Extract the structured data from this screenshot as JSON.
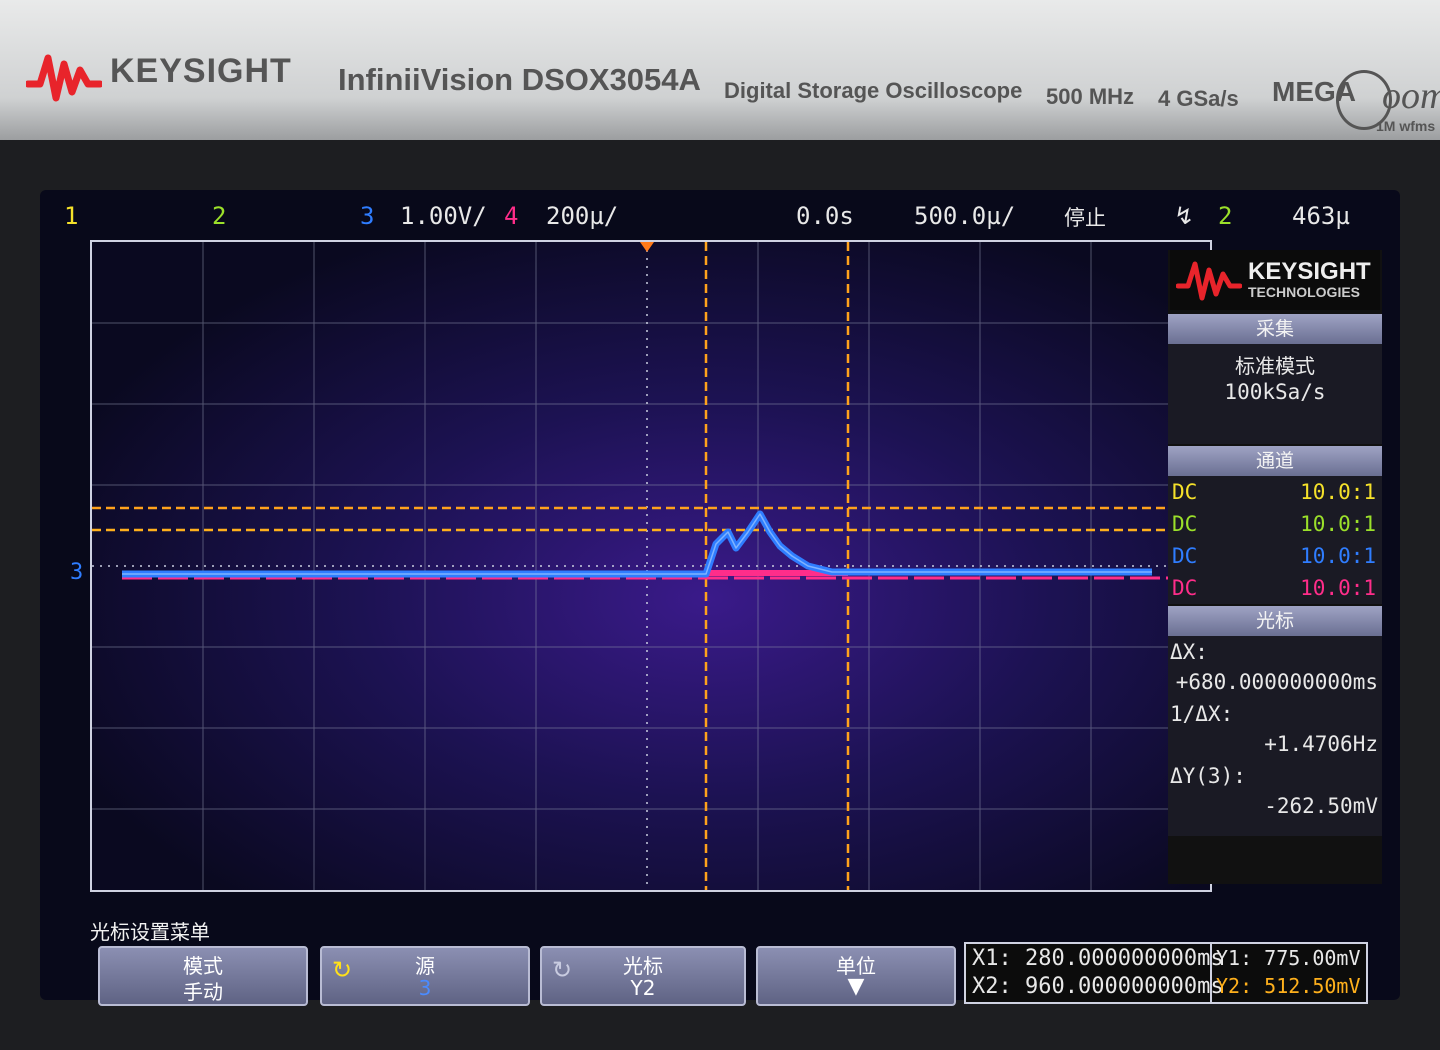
{
  "bezel": {
    "brand": "KEYSIGHT",
    "model": "InfiniiVision DSOX3054A",
    "description": "Digital Storage Oscilloscope",
    "bandwidth": "500 MHz",
    "sample_rate": "4 GSa/s",
    "mega": "MEGA",
    "zoom": "oom",
    "wfms": "1M wfms"
  },
  "status_bar": {
    "ch1": "1",
    "ch2": "2",
    "ch3": "3",
    "ch3_scale": "1.00V/",
    "ch4": "4",
    "ch4_scale": "200µ/",
    "delay": "0.0s",
    "timebase": "500.0µ/",
    "run_state": "停止",
    "trigger_icon": "trigger-edge-icon",
    "trigger_source": "2",
    "trigger_level": "463µ"
  },
  "waveform": {
    "ground_marker": "3",
    "colors": {
      "ch1": "#f5e12a",
      "ch2": "#9be02a",
      "ch3": "#2f7dff",
      "ch4": "#ff2d8a",
      "cursor": "#ffa21c"
    }
  },
  "side_panel": {
    "logo_name": "KEYSIGHT",
    "logo_sub": "TECHNOLOGIES",
    "acquisition": {
      "header": "采集",
      "mode": "标准模式",
      "rate": "100kSa/s"
    },
    "channels": {
      "header": "通道",
      "rows": [
        {
          "coupling": "DC",
          "probe": "10.0:1",
          "color": "#f5e12a"
        },
        {
          "coupling": "DC",
          "probe": "10.0:1",
          "color": "#9be02a"
        },
        {
          "coupling": "DC",
          "probe": "10.0:1",
          "color": "#2f7dff"
        },
        {
          "coupling": "DC",
          "probe": "10.0:1",
          "color": "#ff2d8a"
        }
      ]
    },
    "cursors": {
      "header": "光标",
      "dx_label": "ΔX:",
      "dx_value": "+680.000000000ms",
      "inv_dx_label": "1/ΔX:",
      "inv_dx_value": "+1.4706Hz",
      "dy_label": "ΔY(3):",
      "dy_value": "-262.50mV"
    }
  },
  "softkeys": {
    "menu_title": "光标设置菜单",
    "mode_l1": "模式",
    "mode_l2": "手动",
    "source_l1": "源",
    "source_l2": "3",
    "cursor_l1": "光标",
    "cursor_l2": "Y2",
    "units_l1": "单位"
  },
  "readouts": {
    "x1": "X1: 280.000000000ms",
    "x2": "X2: 960.000000000ms",
    "y1": "Y1: 775.00mV",
    "y2": "Y2: 512.50mV"
  }
}
